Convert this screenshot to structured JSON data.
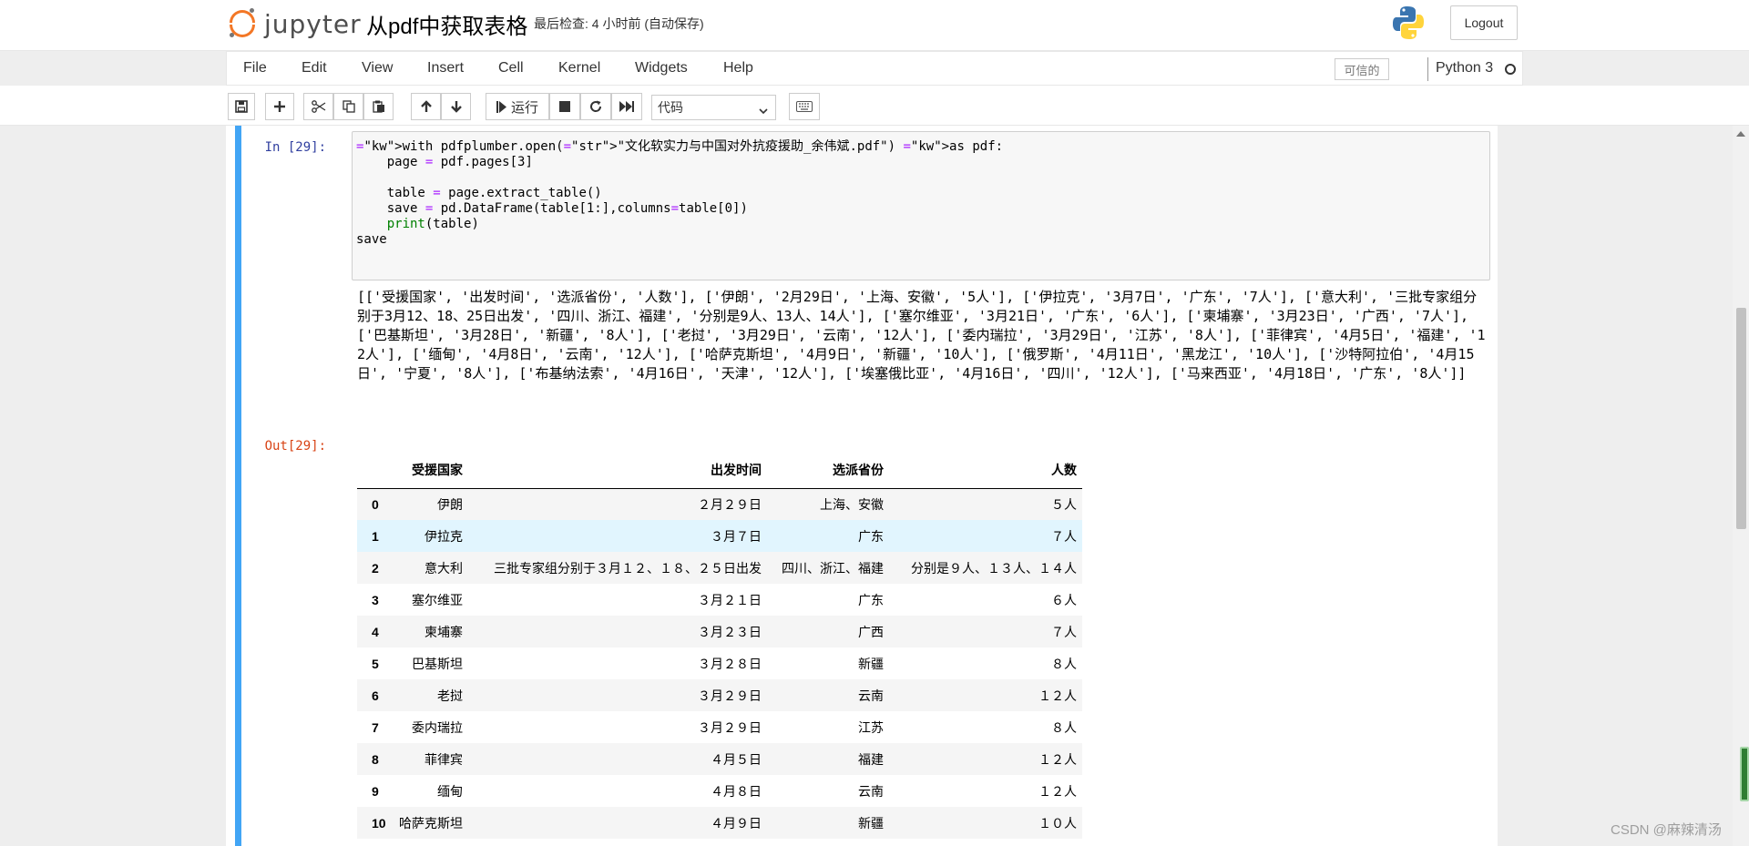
{
  "header": {
    "logo_text": "jupyter",
    "notebook_title": "从pdf中获取表格",
    "checkpoint": "最后检查: 4 小时前  (自动保存)",
    "logout_label": "Logout"
  },
  "menu": {
    "items": [
      "File",
      "Edit",
      "View",
      "Insert",
      "Cell",
      "Kernel",
      "Widgets",
      "Help"
    ],
    "trusted": "可信的",
    "kernel": "Python 3"
  },
  "toolbar": {
    "run_label": "运行",
    "cell_type": "代码",
    "icons": [
      "save-icon",
      "add-icon",
      "cut-icon",
      "copy-icon",
      "paste-icon",
      "arrow-up-icon",
      "arrow-down-icon",
      "run-icon",
      "stop-icon",
      "restart-icon",
      "fast-forward-icon",
      "keyboard-icon"
    ]
  },
  "cell": {
    "in_prompt": "In  [29]:",
    "out_prompt": "Out[29]:",
    "code_lines": [
      "with pdfplumber.open(\"文化软实力与中国对外抗疫援助_余伟斌.pdf\") as pdf:",
      "    page = pdf.pages[3]",
      "",
      "    table = page.extract_table()",
      "    save = pd.DataFrame(table[1:],columns=table[0])",
      "    print(table)",
      "save"
    ],
    "stdout": "[['受援国家', '出发时间', '选派省份', '人数'], ['伊朗', '2月29日', '上海、安徽', '5人'], ['伊拉克', '3月7日', '广东', '7人'], ['意大利', '三批专家组分别于3月12、18、25日出发', '四川、浙江、福建', '分别是9人、13人、14人'], ['塞尔维亚', '3月21日', '广东', '6人'], ['柬埔寨', '3月23日', '广西', '7人'], ['巴基斯坦', '3月28日', '新疆', '8人'], ['老挝', '3月29日', '云南', '12人'], ['委内瑞拉', '3月29日', '江苏', '8人'], ['菲律宾', '4月5日', '福建', '12人'], ['缅甸', '4月8日', '云南', '12人'], ['哈萨克斯坦', '4月9日', '新疆', '10人'], ['俄罗斯', '4月11日', '黑龙江', '10人'], ['沙特阿拉伯', '4月15日', '宁夏', '8人'], ['布基纳法索', '4月16日', '天津', '12人'], ['埃塞俄比亚', '4月16日', '四川', '12人'], ['马来西亚', '4月18日', '广东', '8人']]"
  },
  "dataframe": {
    "columns": [
      "",
      "受援国家",
      "出发时间",
      "选派省份",
      "人数"
    ],
    "rows": [
      [
        "0",
        "伊朗",
        "２月２９日",
        "上海、安徽",
        "５人"
      ],
      [
        "1",
        "伊拉克",
        "３月７日",
        "广东",
        "７人"
      ],
      [
        "2",
        "意大利",
        "三批专家组分别于３月１２、１８、２５日出发",
        "四川、浙江、福建",
        "分别是９人、１３人、１４人"
      ],
      [
        "3",
        "塞尔维亚",
        "３月２１日",
        "广东",
        "６人"
      ],
      [
        "4",
        "柬埔寨",
        "３月２３日",
        "广西",
        "７人"
      ],
      [
        "5",
        "巴基斯坦",
        "３月２８日",
        "新疆",
        "８人"
      ],
      [
        "6",
        "老挝",
        "３月２９日",
        "云南",
        "１２人"
      ],
      [
        "7",
        "委内瑞拉",
        "３月２９日",
        "江苏",
        "８人"
      ],
      [
        "8",
        "菲律宾",
        "４月５日",
        "福建",
        "１２人"
      ],
      [
        "9",
        "缅甸",
        "４月８日",
        "云南",
        "１２人"
      ],
      [
        "10",
        "哈萨克斯坦",
        "４月９日",
        "新疆",
        "１０人"
      ]
    ],
    "highlight_row": 1
  },
  "watermark": "CSDN @麻辣清汤",
  "colors": {
    "cell_border": "#42a5f5",
    "in_prompt": "#303f9f",
    "out_prompt": "#d84315",
    "keyword": "#008000",
    "string": "#ba2121",
    "operator": "#aa22ff"
  }
}
